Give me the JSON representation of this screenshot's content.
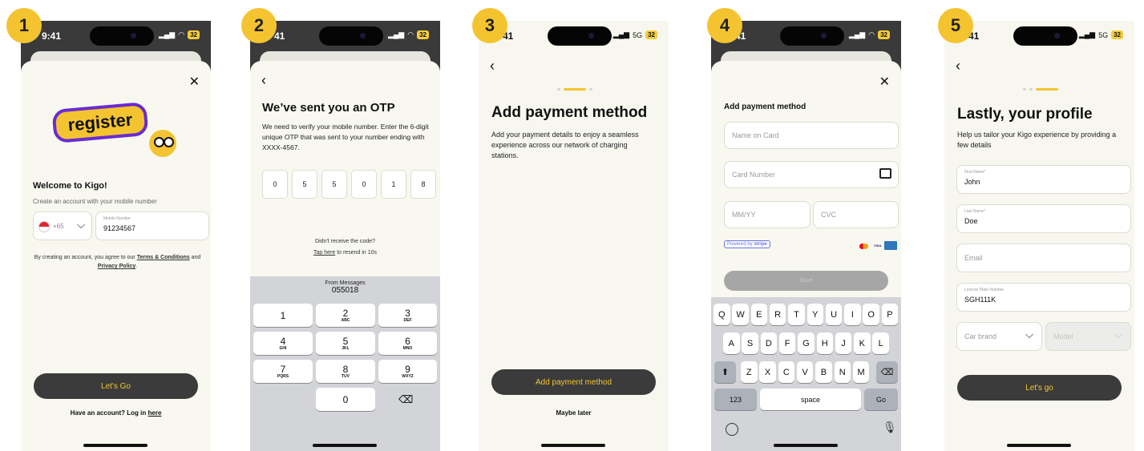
{
  "steps": [
    "1",
    "2",
    "3",
    "4",
    "5"
  ],
  "status": {
    "time_full": "9:41",
    "time_cut": "41",
    "signal_5g": "5G",
    "battery": "32"
  },
  "screen1": {
    "title": "Welcome to Kigo!",
    "subtitle": "Create an account with your mobile number",
    "logo_text": "register",
    "country_code": "+65",
    "mobile_label": "Mobile Number",
    "mobile_value": "91234567",
    "terms_prefix": "By creating an account, you agree to our",
    "terms_link": "Terms & Conditions",
    "terms_and": "and",
    "privacy_link": "Privacy Policy",
    "button": "Let's Go",
    "login_prefix": "Have an account? Log in",
    "login_link": "here"
  },
  "screen2": {
    "title": "We’ve sent you an OTP",
    "body": "We need to verify your mobile number. Enter the 6-digit unique OTP that was sent to your number ending with XXXX-4567.",
    "otp": [
      "0",
      "5",
      "5",
      "0",
      "1",
      "8"
    ],
    "resend_q": "Didn't receive the code?",
    "resend_link": "Tap here",
    "resend_rest": "to resend in 10s",
    "suggestion_label": "From Messages",
    "suggestion_code": "055018",
    "keys": [
      {
        "n": "1",
        "l": ""
      },
      {
        "n": "2",
        "l": "ABC"
      },
      {
        "n": "3",
        "l": "DEF"
      },
      {
        "n": "4",
        "l": "GHI"
      },
      {
        "n": "5",
        "l": "JKL"
      },
      {
        "n": "6",
        "l": "MNO"
      },
      {
        "n": "7",
        "l": "PQRS"
      },
      {
        "n": "8",
        "l": "TUV"
      },
      {
        "n": "9",
        "l": "WXYZ"
      },
      {
        "n": "0",
        "l": ""
      }
    ]
  },
  "screen3": {
    "title": "Add payment method",
    "body": "Add your payment details to enjoy a seamless experience across our network of charging stations.",
    "button": "Add payment method",
    "secondary": "Maybe later"
  },
  "screen4": {
    "title": "Add payment method",
    "name_ph": "Name on Card",
    "card_ph": "Card Number",
    "exp_ph": "MM/YY",
    "cvc_ph": "CVC",
    "powered": "Powered by",
    "stripe": "stripe",
    "visa": "VISA",
    "save": "Save",
    "row1": [
      "Q",
      "W",
      "E",
      "R",
      "T",
      "Y",
      "U",
      "I",
      "O",
      "P"
    ],
    "row2": [
      "A",
      "S",
      "D",
      "F",
      "G",
      "H",
      "J",
      "K",
      "L"
    ],
    "row3": [
      "Z",
      "X",
      "C",
      "V",
      "B",
      "N",
      "M"
    ],
    "k123": "123",
    "space": "space",
    "go": "Go"
  },
  "screen5": {
    "title": "Lastly, your profile",
    "body": "Help us tailor your Kigo experience by providing a few details",
    "first_label": "First Name*",
    "first_value": "John",
    "last_label": "Last Name*",
    "last_value": "Doe",
    "email_ph": "Email",
    "plate_label": "License Plate Number",
    "plate_value": "SGH111K",
    "brand_ph": "Car brand",
    "model_ph": "Model",
    "button": "Let's go"
  },
  "colors": {
    "accent": "#f4c430",
    "dark": "#3b3b3b",
    "background": "#f8f8f0"
  }
}
